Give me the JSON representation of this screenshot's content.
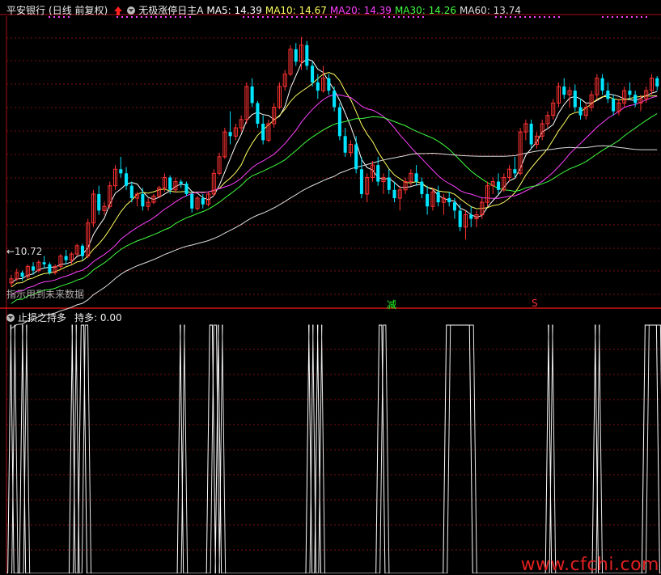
{
  "header": {
    "stock_name": "平安银行",
    "period_label": "(日线 前复权)",
    "indicator_name": "无极涨停日主A",
    "ma_labels": [
      {
        "text": "MA5: 14.39",
        "color": "#ffffff"
      },
      {
        "text": "MA10: 14.67",
        "color": "#ffff60"
      },
      {
        "text": "MA20: 14.39",
        "color": "#ff40ff"
      },
      {
        "text": "MA30: 14.26",
        "color": "#40ff40"
      },
      {
        "text": "MA60: 13.74",
        "color": "#dddddd"
      }
    ]
  },
  "price_panel": {
    "low_marker": "←10.72",
    "future_notice": "指示用到未来数据",
    "signal_jian": "减",
    "signal_s": "S",
    "colors": {
      "up": "#ff3232",
      "down": "#00e5ff",
      "grid": "#7a1010",
      "ma5": "#ffffff",
      "ma10": "#ffff60",
      "ma20": "#ff40ff",
      "ma30": "#40ff40",
      "ma60": "#dddddd"
    }
  },
  "sub_panel": {
    "title": "止损之持多",
    "value_label": "持多: 0.00"
  },
  "watermark": "www.cfchi.com",
  "chart_data": {
    "type": "candlestick",
    "title": "平安银行 (日线 前复权)",
    "ylim": [
      10.2,
      17.2
    ],
    "low_price": 10.72,
    "candles": [
      [
        10.75,
        10.95,
        10.65,
        10.85
      ],
      [
        10.85,
        11.1,
        10.8,
        11.0
      ],
      [
        11.0,
        11.05,
        10.8,
        10.9
      ],
      [
        10.9,
        11.2,
        10.85,
        11.15
      ],
      [
        11.15,
        11.25,
        10.95,
        11.05
      ],
      [
        11.05,
        11.3,
        11.0,
        11.25
      ],
      [
        11.25,
        11.4,
        11.1,
        11.2
      ],
      [
        11.2,
        11.25,
        10.95,
        11.0
      ],
      [
        11.0,
        11.2,
        10.95,
        11.15
      ],
      [
        11.15,
        11.45,
        11.1,
        11.4
      ],
      [
        11.4,
        11.55,
        11.2,
        11.3
      ],
      [
        11.3,
        11.5,
        11.2,
        11.45
      ],
      [
        11.45,
        11.7,
        11.4,
        11.65
      ],
      [
        11.65,
        11.7,
        11.3,
        11.4
      ],
      [
        11.4,
        12.3,
        11.35,
        12.2
      ],
      [
        12.2,
        13.0,
        12.1,
        12.9
      ],
      [
        12.9,
        13.1,
        12.4,
        12.5
      ],
      [
        12.5,
        12.7,
        12.4,
        12.6
      ],
      [
        12.6,
        13.2,
        12.55,
        13.1
      ],
      [
        13.1,
        13.6,
        13.0,
        13.5
      ],
      [
        13.5,
        13.8,
        13.3,
        13.4
      ],
      [
        13.4,
        13.55,
        13.0,
        13.1
      ],
      [
        13.1,
        13.2,
        12.7,
        12.8
      ],
      [
        12.8,
        12.95,
        12.6,
        12.9
      ],
      [
        12.9,
        13.05,
        12.5,
        12.6
      ],
      [
        12.6,
        12.8,
        12.5,
        12.7
      ],
      [
        12.7,
        12.9,
        12.65,
        12.85
      ],
      [
        12.85,
        13.1,
        12.8,
        13.05
      ],
      [
        13.05,
        13.4,
        12.95,
        13.3
      ],
      [
        13.3,
        13.35,
        12.9,
        13.0
      ],
      [
        13.0,
        13.3,
        12.95,
        13.2
      ],
      [
        13.2,
        13.25,
        13.05,
        13.15
      ],
      [
        13.15,
        13.2,
        12.85,
        12.9
      ],
      [
        12.9,
        12.95,
        12.45,
        12.55
      ],
      [
        12.55,
        12.85,
        12.5,
        12.8
      ],
      [
        12.8,
        12.9,
        12.55,
        12.65
      ],
      [
        12.65,
        12.95,
        12.6,
        12.9
      ],
      [
        12.9,
        13.5,
        12.85,
        13.4
      ],
      [
        13.4,
        13.9,
        13.35,
        13.8
      ],
      [
        13.8,
        14.5,
        13.75,
        14.4
      ],
      [
        14.4,
        14.9,
        14.1,
        14.3
      ],
      [
        14.3,
        14.6,
        14.2,
        14.5
      ],
      [
        14.5,
        14.8,
        14.4,
        14.7
      ],
      [
        14.7,
        15.6,
        14.6,
        15.5
      ],
      [
        15.5,
        15.7,
        15.0,
        15.1
      ],
      [
        15.1,
        15.15,
        14.5,
        14.6
      ],
      [
        14.6,
        14.8,
        14.1,
        14.2
      ],
      [
        14.2,
        14.7,
        14.15,
        14.6
      ],
      [
        14.6,
        15.1,
        14.5,
        15.0
      ],
      [
        15.0,
        15.6,
        14.95,
        15.5
      ],
      [
        15.5,
        15.9,
        15.4,
        15.8
      ],
      [
        15.8,
        16.5,
        15.75,
        16.4
      ],
      [
        16.4,
        16.55,
        16.0,
        16.1
      ],
      [
        16.1,
        16.7,
        15.9,
        16.5
      ],
      [
        16.5,
        16.6,
        15.9,
        16.0
      ],
      [
        16.0,
        16.1,
        15.5,
        15.6
      ],
      [
        15.6,
        15.8,
        15.2,
        15.4
      ],
      [
        15.4,
        16.0,
        15.35,
        15.7
      ],
      [
        15.7,
        15.8,
        15.3,
        15.4
      ],
      [
        15.4,
        15.5,
        14.9,
        15.0
      ],
      [
        15.0,
        15.1,
        14.2,
        14.3
      ],
      [
        14.3,
        14.5,
        13.8,
        13.9
      ],
      [
        13.9,
        14.2,
        13.8,
        14.1
      ],
      [
        14.1,
        14.3,
        13.4,
        13.5
      ],
      [
        13.5,
        13.8,
        12.8,
        12.9
      ],
      [
        12.9,
        13.4,
        12.7,
        13.3
      ],
      [
        13.3,
        13.7,
        13.2,
        13.6
      ],
      [
        13.6,
        13.8,
        13.1,
        13.2
      ],
      [
        13.2,
        13.4,
        12.9,
        13.3
      ],
      [
        13.3,
        13.5,
        12.9,
        13.0
      ],
      [
        13.0,
        13.2,
        12.7,
        12.8
      ],
      [
        12.8,
        13.1,
        12.5,
        13.0
      ],
      [
        13.0,
        13.3,
        12.9,
        13.2
      ],
      [
        13.2,
        13.5,
        13.1,
        13.4
      ],
      [
        13.4,
        13.6,
        13.1,
        13.2
      ],
      [
        13.2,
        13.3,
        12.8,
        12.9
      ],
      [
        12.9,
        13.1,
        12.4,
        12.6
      ],
      [
        12.6,
        13.05,
        12.5,
        12.95
      ],
      [
        12.95,
        13.1,
        12.6,
        12.7
      ],
      [
        12.7,
        12.9,
        12.4,
        12.8
      ],
      [
        12.8,
        12.95,
        12.6,
        12.7
      ],
      [
        12.7,
        12.8,
        12.3,
        12.5
      ],
      [
        12.5,
        12.65,
        12.0,
        12.1
      ],
      [
        12.1,
        12.5,
        11.8,
        12.4
      ],
      [
        12.4,
        12.6,
        12.1,
        12.3
      ],
      [
        12.3,
        12.5,
        12.1,
        12.4
      ],
      [
        12.4,
        12.8,
        12.3,
        12.7
      ],
      [
        12.7,
        13.2,
        12.6,
        13.1
      ],
      [
        13.1,
        13.3,
        12.9,
        13.2
      ],
      [
        13.2,
        13.4,
        12.9,
        13.0
      ],
      [
        13.0,
        13.4,
        12.95,
        13.3
      ],
      [
        13.3,
        13.6,
        13.2,
        13.5
      ],
      [
        13.5,
        13.8,
        13.3,
        13.4
      ],
      [
        13.4,
        14.5,
        13.35,
        14.4
      ],
      [
        14.4,
        14.7,
        14.2,
        14.6
      ],
      [
        14.6,
        14.7,
        14.0,
        14.1
      ],
      [
        14.1,
        14.4,
        14.0,
        14.3
      ],
      [
        14.3,
        14.7,
        14.2,
        14.6
      ],
      [
        14.6,
        14.9,
        14.5,
        14.8
      ],
      [
        14.8,
        15.2,
        14.7,
        15.1
      ],
      [
        15.1,
        15.6,
        15.0,
        15.5
      ],
      [
        15.5,
        15.7,
        15.2,
        15.3
      ],
      [
        15.3,
        15.5,
        15.0,
        15.4
      ],
      [
        15.4,
        15.55,
        14.9,
        15.0
      ],
      [
        15.0,
        15.2,
        14.7,
        14.8
      ],
      [
        14.8,
        15.1,
        14.7,
        15.0
      ],
      [
        15.0,
        15.4,
        14.9,
        15.3
      ],
      [
        15.3,
        15.8,
        15.2,
        15.7
      ],
      [
        15.7,
        15.8,
        15.3,
        15.4
      ],
      [
        15.4,
        15.6,
        15.1,
        15.2
      ],
      [
        15.2,
        15.3,
        14.8,
        14.9
      ],
      [
        14.9,
        15.2,
        14.8,
        15.1
      ],
      [
        15.1,
        15.5,
        15.0,
        15.4
      ],
      [
        15.4,
        15.6,
        15.2,
        15.3
      ],
      [
        15.3,
        15.4,
        15.0,
        15.1
      ],
      [
        15.1,
        15.3,
        14.9,
        15.2
      ],
      [
        15.2,
        15.5,
        15.1,
        15.4
      ],
      [
        15.4,
        15.8,
        15.3,
        15.7
      ],
      [
        15.7,
        15.75,
        15.4,
        15.5
      ]
    ],
    "ma_series": [
      {
        "name": "MA5",
        "period": 5,
        "value": 14.39
      },
      {
        "name": "MA10",
        "period": 10,
        "value": 14.67
      },
      {
        "name": "MA20",
        "period": 20,
        "value": 14.39
      },
      {
        "name": "MA30",
        "period": 30,
        "value": 14.26
      },
      {
        "name": "MA60",
        "period": 60,
        "value": 13.74
      }
    ],
    "hold_signal": {
      "name": "持多",
      "ranges": [
        [
          1,
          2
        ],
        [
          5,
          6
        ],
        [
          22,
          23
        ],
        [
          25,
          27
        ],
        [
          59,
          60
        ],
        [
          69,
          71
        ],
        [
          72,
          73
        ],
        [
          103,
          104
        ],
        [
          106,
          107
        ],
        [
          127,
          129
        ],
        [
          150,
          159
        ],
        [
          185,
          186
        ],
        [
          201,
          202
        ],
        [
          218,
          223
        ]
      ],
      "total_steps": 224
    }
  }
}
